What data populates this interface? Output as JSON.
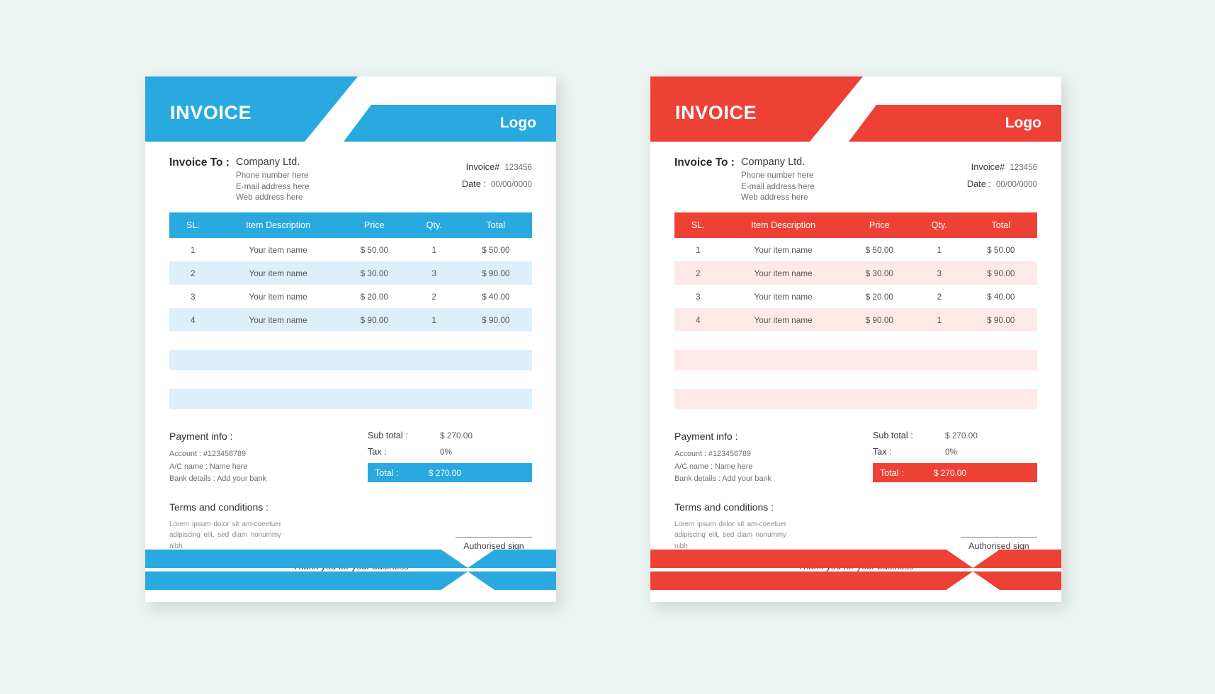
{
  "page": {
    "background": "#ecf4f2"
  },
  "variants": [
    {
      "id": "blue",
      "accent": "#29a9df",
      "row_alt": "#ddeff9",
      "filler": "#ddeff9",
      "header": {
        "title": "INVOICE",
        "logo": "Logo"
      },
      "bill": {
        "label": "Invoice To :",
        "company": "Company Ltd.",
        "line1": "Phone number here",
        "line2": "E-mail address here",
        "line3": "Web address here"
      },
      "meta": {
        "invoice_label": "Invoice#",
        "invoice_value": "123456",
        "date_label": "Date :",
        "date_value": "00/00/0000"
      },
      "table": {
        "columns": [
          "SL.",
          "Item Description",
          "Price",
          "Qty.",
          "Total"
        ],
        "rows": [
          {
            "sl": "1",
            "desc": "Your item name",
            "price": "$ 50.00",
            "qty": "1",
            "total": "$ 50.00"
          },
          {
            "sl": "2",
            "desc": "Your item name",
            "price": "$ 30.00",
            "qty": "3",
            "total": "$ 90.00"
          },
          {
            "sl": "3",
            "desc": "Your item name",
            "price": "$ 20.00",
            "qty": "2",
            "total": "$ 40.00"
          },
          {
            "sl": "4",
            "desc": "Your item name",
            "price": "$ 90.00",
            "qty": "1",
            "total": "$ 90.00"
          }
        ]
      },
      "payment": {
        "title": "Payment info :",
        "account": "Account :  #123456789",
        "ac_name": "A/C name :  Name here",
        "bank": "Bank details :  Add your bank"
      },
      "totals": {
        "subtotal_label": "Sub total :",
        "subtotal_value": "$ 270.00",
        "tax_label": "Tax :",
        "tax_value": "0%",
        "total_label": "Total :",
        "total_value": "$ 270.00"
      },
      "terms": {
        "title": "Terms and conditions :",
        "body": "Lorem ipsum dolor sit am-coeetuer adipiscing elit, sed diam nonummy nibh"
      },
      "signature": {
        "label": "Authorised sign"
      },
      "thanks": "Thank you for your business"
    },
    {
      "id": "red",
      "accent": "#ed4135",
      "row_alt": "#fdeae8",
      "filler": "#fdeae8",
      "header": {
        "title": "INVOICE",
        "logo": "Logo"
      },
      "bill": {
        "label": "Invoice To :",
        "company": "Company Ltd.",
        "line1": "Phone number here",
        "line2": "E-mail address here",
        "line3": "Web address here"
      },
      "meta": {
        "invoice_label": "Invoice#",
        "invoice_value": "123456",
        "date_label": "Date :",
        "date_value": "00/00/0000"
      },
      "table": {
        "columns": [
          "SL.",
          "Item Description",
          "Price",
          "Qty.",
          "Total"
        ],
        "rows": [
          {
            "sl": "1",
            "desc": "Your item name",
            "price": "$ 50.00",
            "qty": "1",
            "total": "$ 50.00"
          },
          {
            "sl": "2",
            "desc": "Your item name",
            "price": "$ 30.00",
            "qty": "3",
            "total": "$ 90.00"
          },
          {
            "sl": "3",
            "desc": "Your item name",
            "price": "$ 20.00",
            "qty": "2",
            "total": "$ 40.00"
          },
          {
            "sl": "4",
            "desc": "Your item name",
            "price": "$ 90.00",
            "qty": "1",
            "total": "$ 90.00"
          }
        ]
      },
      "payment": {
        "title": "Payment info :",
        "account": "Account :  #123456789",
        "ac_name": "A/C name :  Name here",
        "bank": "Bank details :  Add your bank"
      },
      "totals": {
        "subtotal_label": "Sub total :",
        "subtotal_value": "$ 270.00",
        "tax_label": "Tax :",
        "tax_value": "0%",
        "total_label": "Total :",
        "total_value": "$ 270.00"
      },
      "terms": {
        "title": "Terms and conditions :",
        "body": "Lorem ipsum dolor sit am-coeetuer adipiscing elit, sed diam nonummy nibh"
      },
      "signature": {
        "label": "Authorised sign"
      },
      "thanks": "Thank you for your business"
    }
  ]
}
